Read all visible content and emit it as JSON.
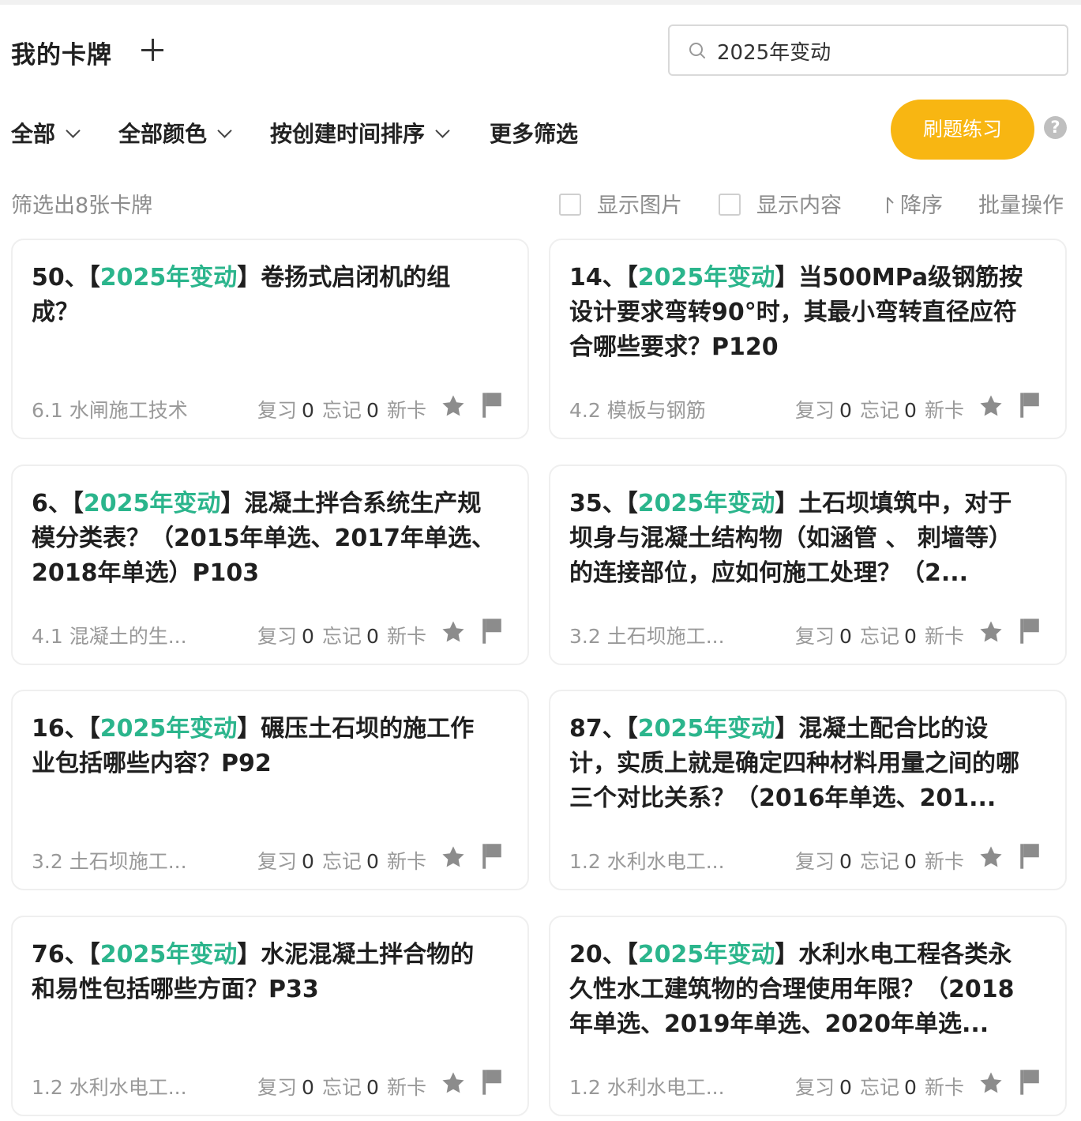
{
  "header": {
    "title": "我的卡牌",
    "search": {
      "value": "2025年变动",
      "placeholder": ""
    }
  },
  "filters": {
    "scope": "全部",
    "color": "全部颜色",
    "sort": "按创建时间排序",
    "more": "更多筛选",
    "practice_label": "刷题练习",
    "help_symbol": "?"
  },
  "info": {
    "count_text": "筛选出8张卡牌",
    "show_images": "显示图片",
    "show_content": "显示内容",
    "order": "降序",
    "batch": "批量操作"
  },
  "colors": {
    "accent": "#f8b612",
    "highlight": "#2bb58c",
    "icon_gray": "#8c8c8c"
  },
  "icons": {
    "search": "search-icon",
    "star": "star-icon",
    "flag": "flag-icon",
    "add": "plus-icon",
    "help": "help-icon"
  },
  "cards": [
    {
      "num": "50、",
      "open": "【",
      "tag": "2025年变动",
      "close": "】",
      "title": "卷扬式启闭机的组成？",
      "chapter": "6.1 水闸施工技术",
      "review_label": "复习",
      "review": "0",
      "forget_label": "忘记",
      "forget": "0",
      "status": "新卡"
    },
    {
      "num": "14、",
      "open": "【",
      "tag": "2025年变动",
      "close": "】",
      "title": "当500MPa级钢筋按设计要求弯转90°时，其最小弯转直径应符合哪些要求？P120",
      "chapter": "4.2 模板与钢筋",
      "review_label": "复习",
      "review": "0",
      "forget_label": "忘记",
      "forget": "0",
      "status": "新卡"
    },
    {
      "num": "6、",
      "open": "【",
      "tag": "2025年变动",
      "close": "】",
      "title": "混凝土拌合系统生产规模分类表？（2015年单选、2017年单选、2018年单选）P103",
      "chapter": "4.1 混凝土的生...",
      "review_label": "复习",
      "review": "0",
      "forget_label": "忘记",
      "forget": "0",
      "status": "新卡"
    },
    {
      "num": "35、",
      "open": "【",
      "tag": "2025年变动",
      "close": "】",
      "title": "土石坝填筑中，对于坝身与混凝土结构物（如涵管 、 刺墙等）的连接部位，应如何施工处理？（2...",
      "chapter": "3.2 土石坝施工...",
      "review_label": "复习",
      "review": "0",
      "forget_label": "忘记",
      "forget": "0",
      "status": "新卡"
    },
    {
      "num": "16、",
      "open": "【",
      "tag": "2025年变动",
      "close": "】",
      "title": "碾压土石坝的施工作业包括哪些内容？P92",
      "chapter": "3.2 土石坝施工...",
      "review_label": "复习",
      "review": "0",
      "forget_label": "忘记",
      "forget": "0",
      "status": "新卡"
    },
    {
      "num": "87、",
      "open": "【",
      "tag": "2025年变动",
      "close": "】",
      "title": "混凝土配合比的设计，实质上就是确定四种材料用量之间的哪三个对比关系？（2016年单选、201...",
      "chapter": "1.2 水利水电工...",
      "review_label": "复习",
      "review": "0",
      "forget_label": "忘记",
      "forget": "0",
      "status": "新卡"
    },
    {
      "num": "76、",
      "open": "【",
      "tag": "2025年变动",
      "close": "】",
      "title": "水泥混凝土拌合物的和易性包括哪些方面？P33",
      "chapter": "1.2 水利水电工...",
      "review_label": "复习",
      "review": "0",
      "forget_label": "忘记",
      "forget": "0",
      "status": "新卡"
    },
    {
      "num": "20、",
      "open": "【",
      "tag": "2025年变动",
      "close": "】",
      "title": "水利水电工程各类永久性水工建筑物的合理使用年限？（2018年单选、2019年单选、2020年单选...",
      "chapter": "1.2 水利水电工...",
      "review_label": "复习",
      "review": "0",
      "forget_label": "忘记",
      "forget": "0",
      "status": "新卡"
    }
  ]
}
